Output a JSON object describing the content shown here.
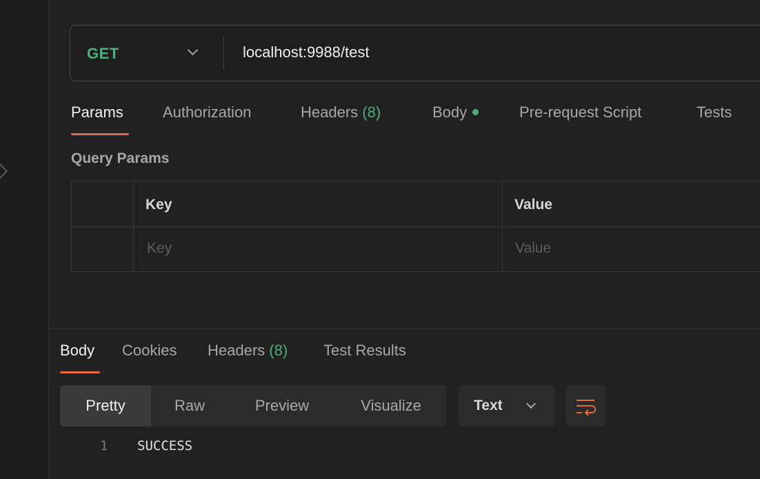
{
  "request": {
    "method": "GET",
    "url": "localhost:9988/test"
  },
  "request_tabs": [
    {
      "label": "Params",
      "active": true
    },
    {
      "label": "Authorization"
    },
    {
      "label": "Headers",
      "count": "(8)"
    },
    {
      "label": "Body",
      "indicator": "green-dot"
    },
    {
      "label": "Pre-request Script"
    },
    {
      "label": "Tests"
    }
  ],
  "query_params": {
    "title": "Query Params",
    "columns": [
      "Key",
      "Value"
    ],
    "placeholders": {
      "key": "Key",
      "value": "Value"
    }
  },
  "response_tabs": [
    {
      "label": "Body",
      "active": true
    },
    {
      "label": "Cookies"
    },
    {
      "label": "Headers",
      "count": "(8)"
    },
    {
      "label": "Test Results"
    }
  ],
  "response_view": {
    "modes": [
      "Pretty",
      "Raw",
      "Preview",
      "Visualize"
    ],
    "active_mode": "Pretty",
    "format": "Text",
    "wrap_icon": "wrap-lines-icon"
  },
  "response_body": [
    {
      "line": "1",
      "text": "SUCCESS"
    }
  ],
  "colors": {
    "accent": "#e8693f",
    "success": "#4caf7d",
    "background": "#212121"
  }
}
